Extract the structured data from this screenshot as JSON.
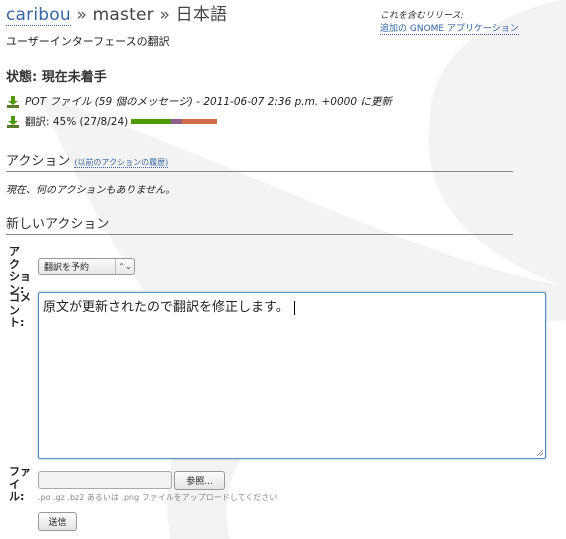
{
  "header": {
    "module": "caribou",
    "sep1": "»",
    "branch": "master",
    "sep2": "»",
    "language": "日本語",
    "subtitle": "ユーザーインターフェースの翻訳",
    "release_label": "これを含むリリース:",
    "release_link": "追加の GNOME アプリケーション"
  },
  "status": {
    "title": "状態: 現在未着手",
    "pot_line": "POT ファイル (59 個のメッセージ) - 2011-06-07 2:36 p.m. +0000 に更新",
    "translation_line": "翻訳: 45% (27/8/24)",
    "progress": {
      "translated": 27,
      "fuzzy": 8,
      "untranslated": 24
    }
  },
  "actions": {
    "heading": "アクション",
    "history_link": "(以前のアクションの履歴)",
    "none_text": "現在、何のアクションもありません。"
  },
  "new_action": {
    "heading": "新しいアクション",
    "action_label": [
      "ア",
      "ク",
      "ショ",
      "ン:"
    ],
    "action_select_value": "翻訳を予約",
    "comment_label": [
      "コメ",
      "ン",
      "ト:"
    ],
    "comment_value": "原文が更新されたので翻訳を修正します。",
    "file_label": [
      "ファ",
      "イ",
      "ル:"
    ],
    "browse_button": "参照...",
    "file_hint": ".po .gz .bz2 あるいは .png ファイルをアップロードしてください",
    "submit_button": "送信"
  },
  "colors": {
    "link": "#3465a4",
    "translated": "#4e9a06",
    "fuzzy": "#8e5d8c",
    "untranslated": "#d66a4c"
  }
}
